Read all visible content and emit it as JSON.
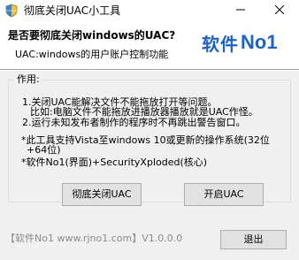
{
  "window": {
    "title": "彻底关闭UAC小工具",
    "minimize_symbol": "—",
    "close_symbol": "✕"
  },
  "header": {
    "title": "是否要彻底关闭windows的UAC?",
    "subtitle": "UAC:windows的用户账户控制功能",
    "logo_cn": "软件",
    "logo_en": "No1",
    "logo_color": "#1e63c4"
  },
  "group": {
    "label": "作用:",
    "lines": [
      "1.关闭UAC能解决文件不能拖放打开等问题。",
      "比如:电脑文件不能拖放进播放器播放就是UAC作怪。",
      "2.运行未知发布者制作的程序时不再跳出警告窗口。",
      "*此工具支持Vista至windows 10或更新的操作系统(32位",
      "+64位)",
      "*软件No1(界面)+SecurityXploded(核心)"
    ]
  },
  "buttons": {
    "disable_uac": "彻底关闭UAC",
    "enable_uac": "开启UAC",
    "exit": "退出"
  },
  "footer": {
    "text": "【软件No1 www.rjno1.com】V1.0.0.0"
  },
  "icons": {
    "app": "shield-app-icon",
    "minimize": "minimize-icon",
    "close": "close-icon"
  }
}
